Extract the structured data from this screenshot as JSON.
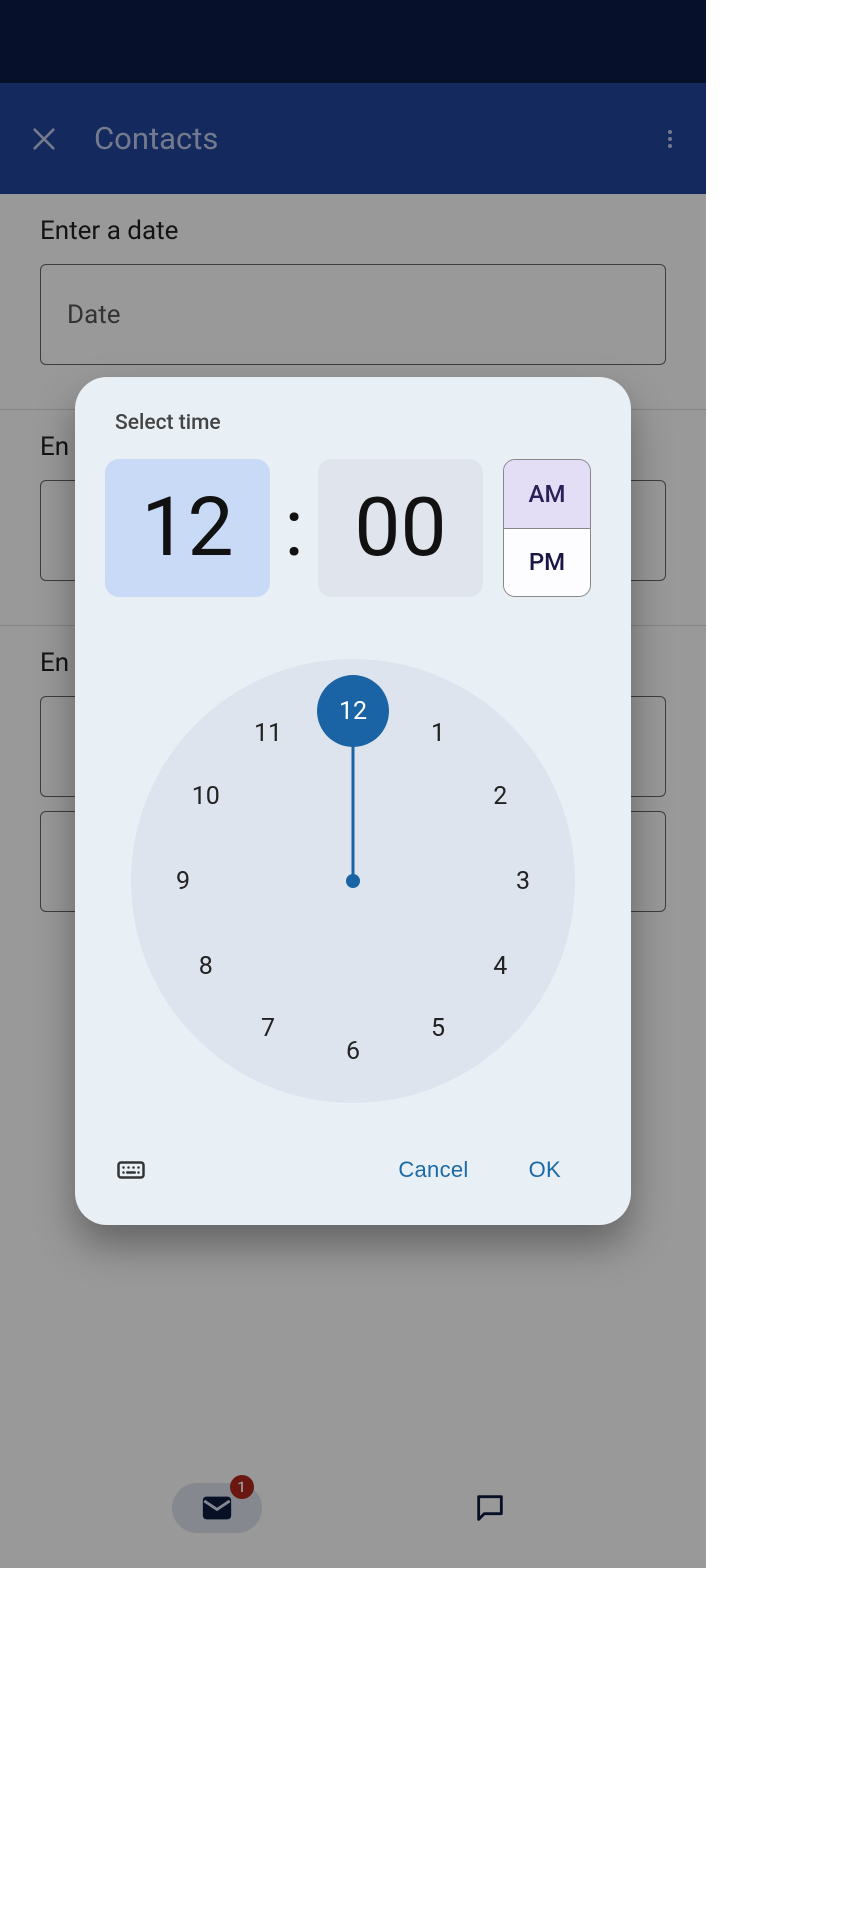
{
  "appbar": {
    "title": "Contacts"
  },
  "sections": {
    "date": {
      "label": "Enter a date",
      "placeholder": "Date"
    },
    "time": {
      "label_prefix": "En"
    },
    "extra": {
      "label_prefix": "En"
    }
  },
  "dialog": {
    "title": "Select time",
    "hour": "12",
    "minute": "00",
    "colon": ":",
    "am": "AM",
    "pm": "PM",
    "selected_period": "AM",
    "selected_hour": 12,
    "clock_numbers": [
      "12",
      "1",
      "2",
      "3",
      "4",
      "5",
      "6",
      "7",
      "8",
      "9",
      "10",
      "11"
    ],
    "cancel": "Cancel",
    "ok": "OK"
  },
  "bottomnav": {
    "badge": "1"
  }
}
